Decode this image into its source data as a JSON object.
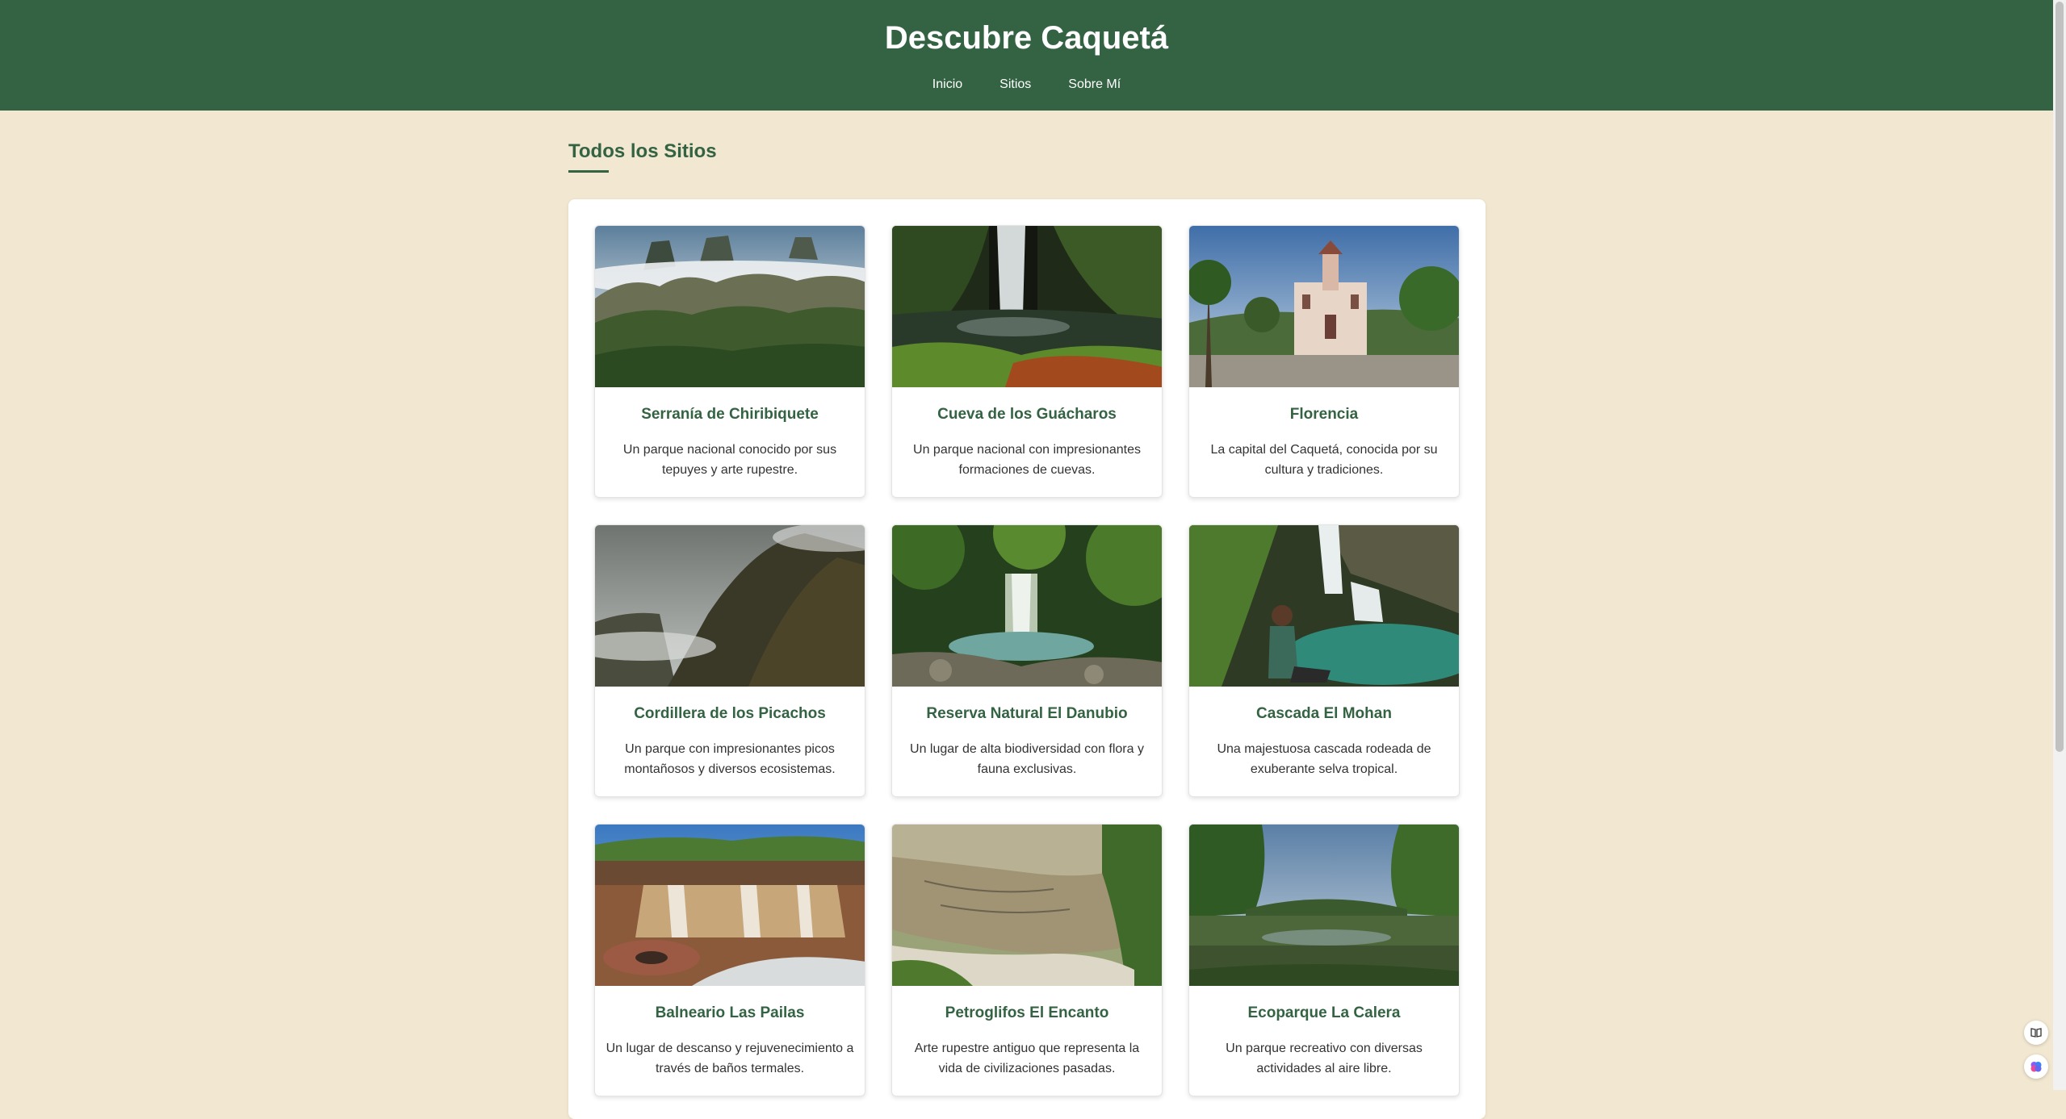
{
  "header": {
    "title": "Descubre Caquetá",
    "nav": [
      "Inicio",
      "Sitios",
      "Sobre Mí"
    ]
  },
  "main": {
    "section_title": "Todos los Sitios",
    "cards": [
      {
        "title": "Serranía de Chiribiquete",
        "desc": "Un parque nacional conocido por sus tepuyes y arte rupestre."
      },
      {
        "title": "Cueva de los Guácharos",
        "desc": "Un parque nacional con impresionantes formaciones de cuevas."
      },
      {
        "title": "Florencia",
        "desc": "La capital del Caquetá, conocida por su cultura y tradiciones."
      },
      {
        "title": "Cordillera de los Picachos",
        "desc": "Un parque con impresionantes picos montañosos y diversos ecosistemas."
      },
      {
        "title": "Reserva Natural El Danubio",
        "desc": "Un lugar de alta biodiversidad con flora y fauna exclusivas."
      },
      {
        "title": "Cascada El Mohan",
        "desc": "Una majestuosa cascada rodeada de exuberante selva tropical."
      },
      {
        "title": "Balneario Las Pailas",
        "desc": "Un lugar de descanso y rejuvenecimiento a través de baños termales."
      },
      {
        "title": "Petroglifos El Encanto",
        "desc": "Arte rupestre antiguo que representa la vida de civilizaciones pasadas."
      },
      {
        "title": "Ecoparque La Calera",
        "desc": "Un parque recreativo con diversas actividades al aire libre."
      }
    ]
  },
  "colors": {
    "header_bg": "#346343",
    "page_bg": "#f2e7d0",
    "accent": "#346343"
  },
  "icons": [
    "book-icon",
    "brain-icon"
  ]
}
